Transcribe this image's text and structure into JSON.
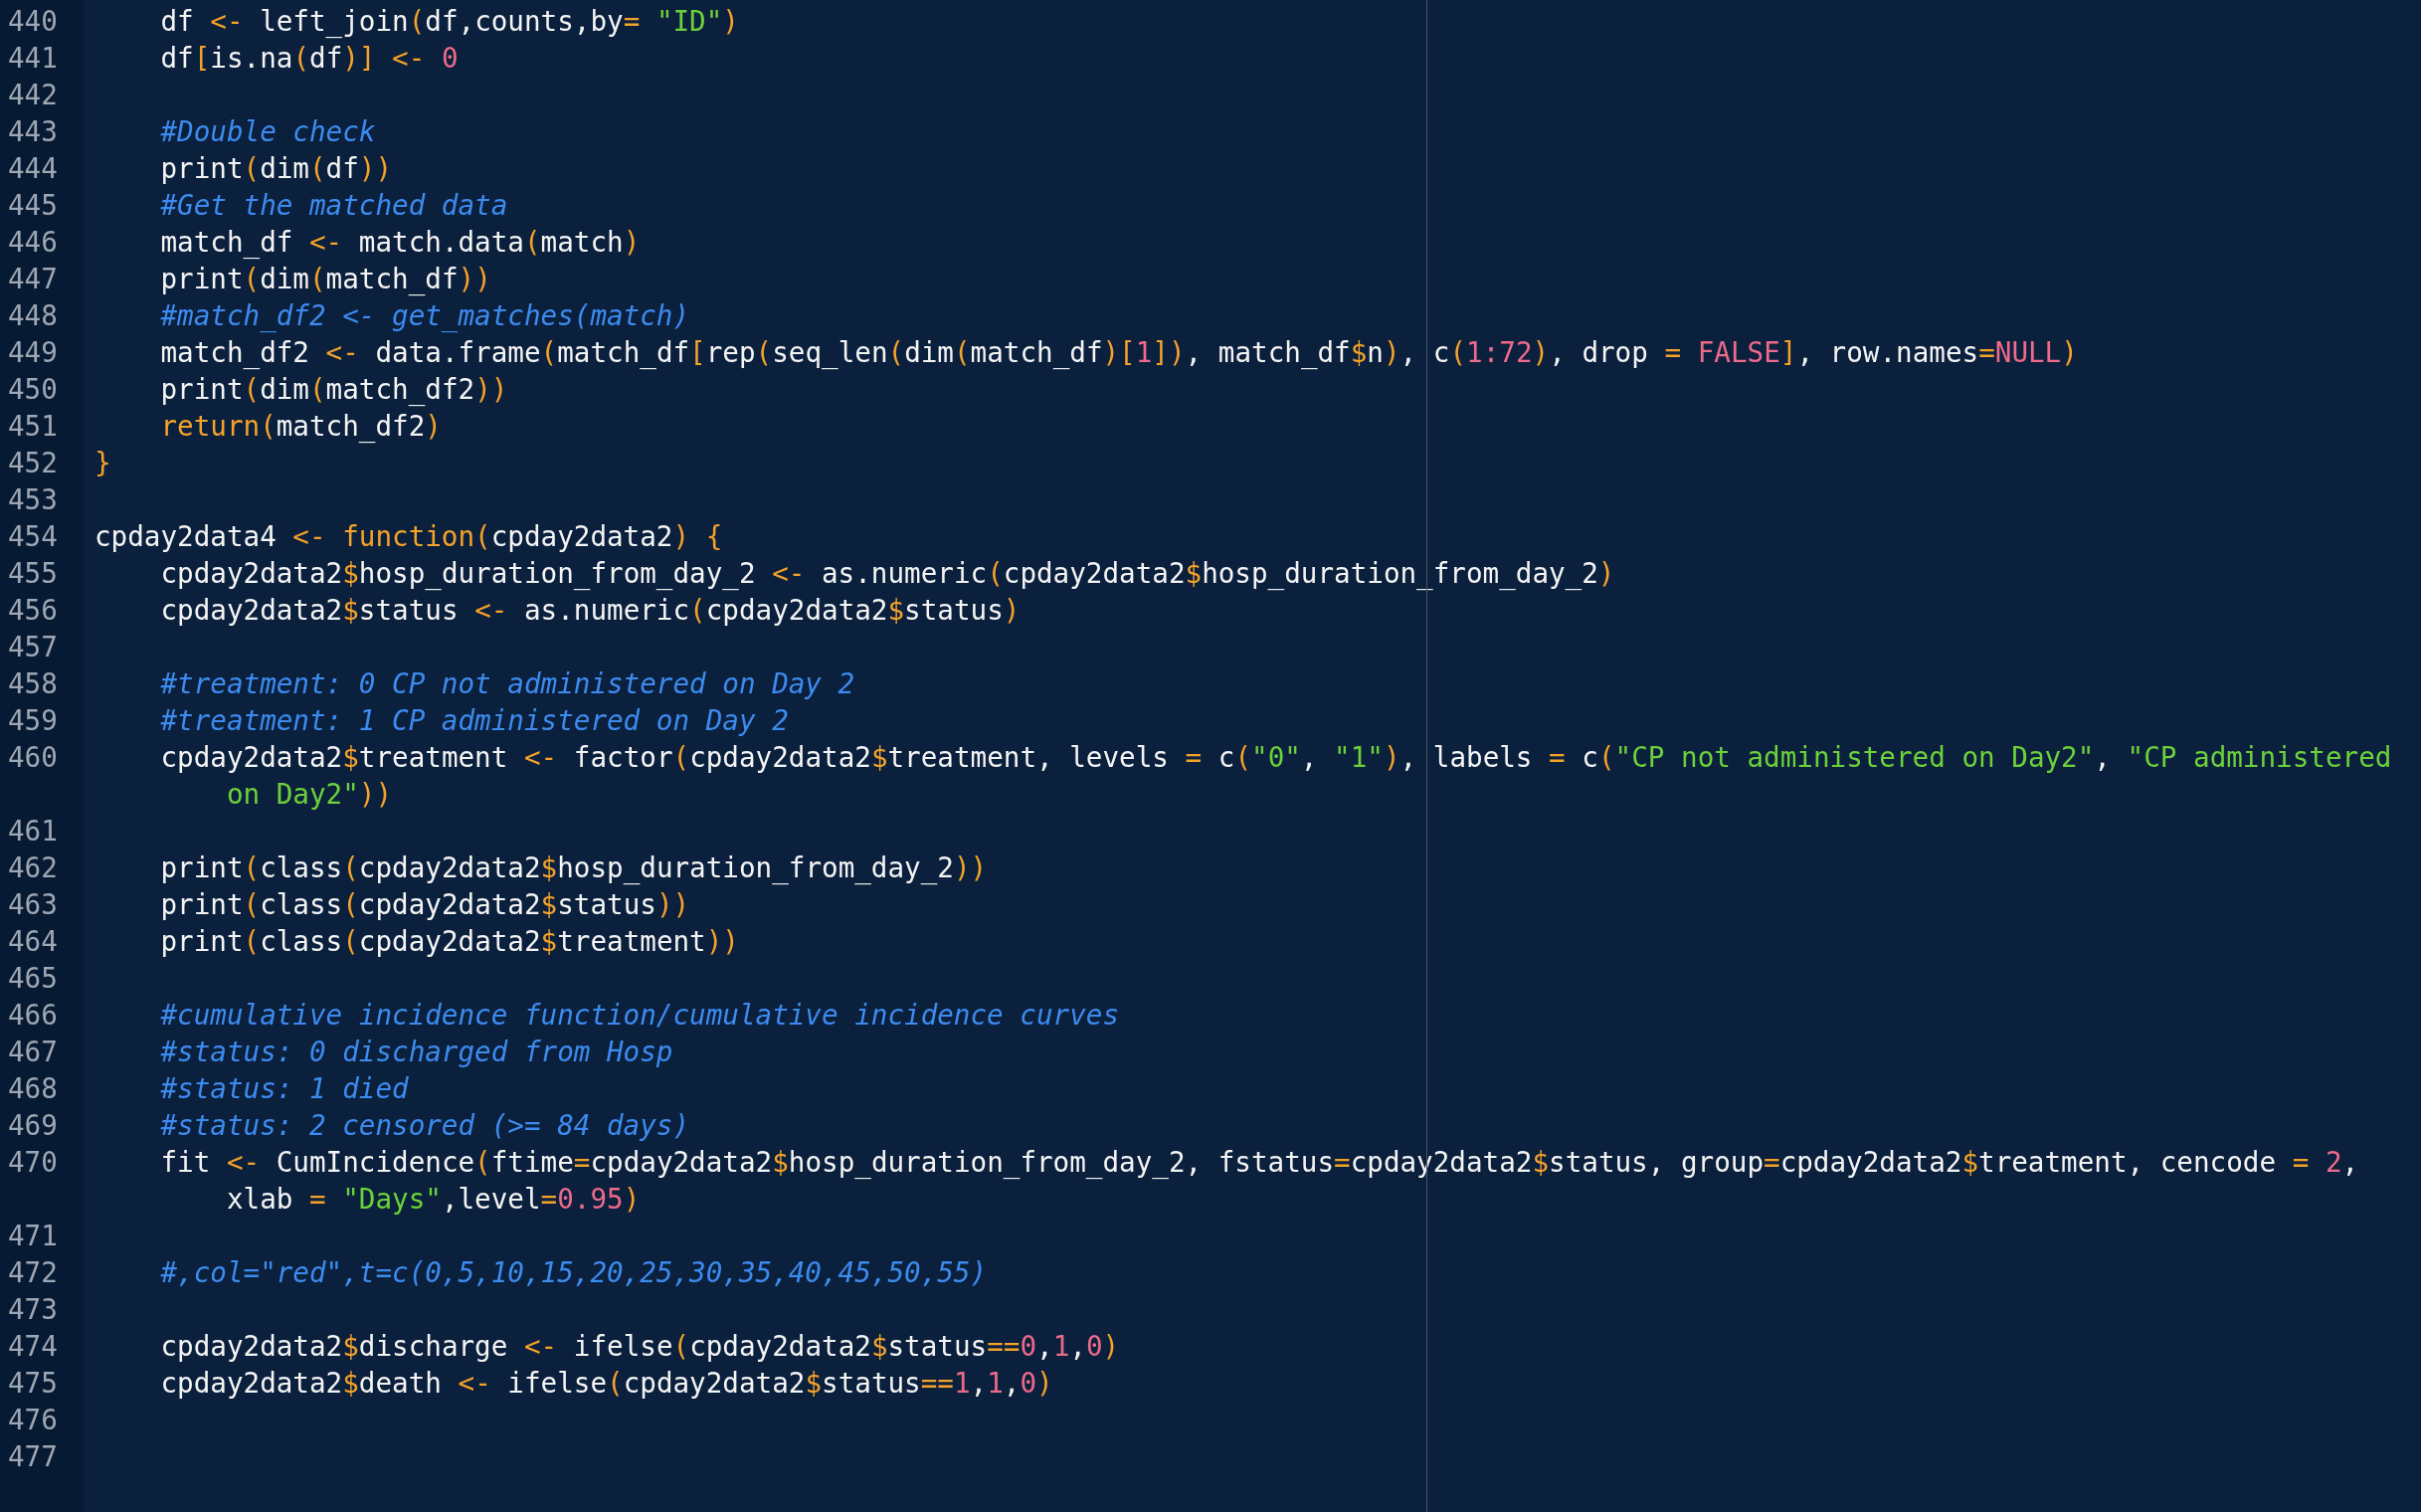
{
  "editor": {
    "lines": [
      {
        "number": "440",
        "tokens": [
          {
            "kind": "plain",
            "text": "    df "
          },
          {
            "kind": "operator",
            "text": "<-"
          },
          {
            "kind": "plain",
            "text": " left_join"
          },
          {
            "kind": "operator",
            "text": "("
          },
          {
            "kind": "plain",
            "text": "df,counts,by"
          },
          {
            "kind": "operator",
            "text": "="
          },
          {
            "kind": "string",
            "text": " \"ID\""
          },
          {
            "kind": "operator",
            "text": ")"
          }
        ]
      },
      {
        "number": "441",
        "tokens": [
          {
            "kind": "plain",
            "text": "    df"
          },
          {
            "kind": "operator",
            "text": "["
          },
          {
            "kind": "plain",
            "text": "is.na"
          },
          {
            "kind": "operator",
            "text": "("
          },
          {
            "kind": "plain",
            "text": "df"
          },
          {
            "kind": "operator",
            "text": ")] <-"
          },
          {
            "kind": "number",
            "text": " 0"
          }
        ]
      },
      {
        "number": "442"
      },
      {
        "number": "443",
        "tokens": [
          {
            "kind": "comment",
            "text": "    #Double check"
          }
        ]
      },
      {
        "number": "444",
        "tokens": [
          {
            "kind": "plain",
            "text": "    print"
          },
          {
            "kind": "operator",
            "text": "("
          },
          {
            "kind": "plain",
            "text": "dim"
          },
          {
            "kind": "operator",
            "text": "("
          },
          {
            "kind": "plain",
            "text": "df"
          },
          {
            "kind": "operator",
            "text": "))"
          }
        ]
      },
      {
        "number": "445",
        "tokens": [
          {
            "kind": "comment",
            "text": "    #Get the matched data"
          }
        ]
      },
      {
        "number": "446",
        "tokens": [
          {
            "kind": "plain",
            "text": "    match_df "
          },
          {
            "kind": "operator",
            "text": "<-"
          },
          {
            "kind": "plain",
            "text": " match.data"
          },
          {
            "kind": "operator",
            "text": "("
          },
          {
            "kind": "plain",
            "text": "match"
          },
          {
            "kind": "operator",
            "text": ")"
          }
        ]
      },
      {
        "number": "447",
        "tokens": [
          {
            "kind": "plain",
            "text": "    print"
          },
          {
            "kind": "operator",
            "text": "("
          },
          {
            "kind": "plain",
            "text": "dim"
          },
          {
            "kind": "operator",
            "text": "("
          },
          {
            "kind": "plain",
            "text": "match_df"
          },
          {
            "kind": "operator",
            "text": "))"
          }
        ]
      },
      {
        "number": "448",
        "tokens": [
          {
            "kind": "comment",
            "text": "    #match_df2 <- get_matches(match)"
          }
        ]
      },
      {
        "number": "449",
        "tokens": [
          {
            "kind": "plain",
            "text": "    match_df2 "
          },
          {
            "kind": "operator",
            "text": "<-"
          },
          {
            "kind": "plain",
            "text": " data.frame"
          },
          {
            "kind": "operator",
            "text": "("
          },
          {
            "kind": "plain",
            "text": "match_df"
          },
          {
            "kind": "operator",
            "text": "["
          },
          {
            "kind": "plain",
            "text": "rep"
          },
          {
            "kind": "operator",
            "text": "("
          },
          {
            "kind": "plain",
            "text": "seq_len"
          },
          {
            "kind": "operator",
            "text": "("
          },
          {
            "kind": "plain",
            "text": "dim"
          },
          {
            "kind": "operator",
            "text": "("
          },
          {
            "kind": "plain",
            "text": "match_df"
          },
          {
            "kind": "operator",
            "text": ")["
          },
          {
            "kind": "number",
            "text": "1"
          },
          {
            "kind": "operator",
            "text": "])"
          },
          {
            "kind": "plain",
            "text": ", match_df"
          },
          {
            "kind": "operator",
            "text": "$"
          },
          {
            "kind": "plain",
            "text": "n"
          },
          {
            "kind": "operator",
            "text": ")"
          },
          {
            "kind": "plain",
            "text": ", c"
          },
          {
            "kind": "operator",
            "text": "("
          },
          {
            "kind": "number",
            "text": "1:72"
          },
          {
            "kind": "operator",
            "text": ")"
          },
          {
            "kind": "plain",
            "text": ", drop "
          },
          {
            "kind": "operator",
            "text": "="
          },
          {
            "kind": "number",
            "text": " FALSE"
          },
          {
            "kind": "operator",
            "text": "]"
          },
          {
            "kind": "plain",
            "text": ", row.names"
          },
          {
            "kind": "operator",
            "text": "="
          },
          {
            "kind": "number",
            "text": "NULL"
          },
          {
            "kind": "operator",
            "text": ")"
          }
        ]
      },
      {
        "number": "450",
        "tokens": [
          {
            "kind": "plain",
            "text": "    print"
          },
          {
            "kind": "operator",
            "text": "("
          },
          {
            "kind": "plain",
            "text": "dim"
          },
          {
            "kind": "operator",
            "text": "("
          },
          {
            "kind": "plain",
            "text": "match_df2"
          },
          {
            "kind": "operator",
            "text": "))"
          }
        ]
      },
      {
        "number": "451",
        "tokens": [
          {
            "kind": "operator",
            "text": "    return("
          },
          {
            "kind": "plain",
            "text": "match_df2"
          },
          {
            "kind": "operator",
            "text": ")"
          }
        ]
      },
      {
        "number": "452",
        "tokens": [
          {
            "kind": "operator",
            "text": "}"
          }
        ]
      },
      {
        "number": "453"
      },
      {
        "number": "454",
        "tokens": [
          {
            "kind": "plain",
            "text": "cpday2data4 "
          },
          {
            "kind": "operator",
            "text": "<- function("
          },
          {
            "kind": "plain",
            "text": "cpday2data2"
          },
          {
            "kind": "operator",
            "text": ") {"
          }
        ]
      },
      {
        "number": "455",
        "tokens": [
          {
            "kind": "plain",
            "text": "    cpday2data2"
          },
          {
            "kind": "operator",
            "text": "$"
          },
          {
            "kind": "plain",
            "text": "hosp_duration_from_day_2 "
          },
          {
            "kind": "operator",
            "text": "<-"
          },
          {
            "kind": "plain",
            "text": " as.numeric"
          },
          {
            "kind": "operator",
            "text": "("
          },
          {
            "kind": "plain",
            "text": "cpday2data2"
          },
          {
            "kind": "operator",
            "text": "$"
          },
          {
            "kind": "plain",
            "text": "hosp_duration_from_day_2"
          },
          {
            "kind": "operator",
            "text": ")"
          }
        ]
      },
      {
        "number": "456",
        "tokens": [
          {
            "kind": "plain",
            "text": "    cpday2data2"
          },
          {
            "kind": "operator",
            "text": "$"
          },
          {
            "kind": "plain",
            "text": "status "
          },
          {
            "kind": "operator",
            "text": "<-"
          },
          {
            "kind": "plain",
            "text": " as.numeric"
          },
          {
            "kind": "operator",
            "text": "("
          },
          {
            "kind": "plain",
            "text": "cpday2data2"
          },
          {
            "kind": "operator",
            "text": "$"
          },
          {
            "kind": "plain",
            "text": "status"
          },
          {
            "kind": "operator",
            "text": ")"
          }
        ]
      },
      {
        "number": "457"
      },
      {
        "number": "458",
        "tokens": [
          {
            "kind": "comment",
            "text": "    #treatment: 0 CP not administered on Day 2"
          }
        ]
      },
      {
        "number": "459",
        "tokens": [
          {
            "kind": "comment",
            "text": "    #treatment: 1 CP administered on Day 2"
          }
        ]
      },
      {
        "number": "460",
        "tokens": [
          {
            "kind": "plain",
            "text": "    cpday2data2"
          },
          {
            "kind": "operator",
            "text": "$"
          },
          {
            "kind": "plain",
            "text": "treatment "
          },
          {
            "kind": "operator",
            "text": "<-"
          },
          {
            "kind": "plain",
            "text": " factor"
          },
          {
            "kind": "operator",
            "text": "("
          },
          {
            "kind": "plain",
            "text": "cpday2data2"
          },
          {
            "kind": "operator",
            "text": "$"
          },
          {
            "kind": "plain",
            "text": "treatment, levels "
          },
          {
            "kind": "operator",
            "text": "="
          },
          {
            "kind": "plain",
            "text": " c"
          },
          {
            "kind": "operator",
            "text": "("
          },
          {
            "kind": "string",
            "text": "\"0\""
          },
          {
            "kind": "plain",
            "text": ", "
          },
          {
            "kind": "string",
            "text": "\"1\""
          },
          {
            "kind": "operator",
            "text": ")"
          },
          {
            "kind": "plain",
            "text": ", labels "
          },
          {
            "kind": "operator",
            "text": "="
          },
          {
            "kind": "plain",
            "text": " c"
          },
          {
            "kind": "operator",
            "text": "("
          },
          {
            "kind": "string",
            "text": "\"CP not administered on Day2\""
          },
          {
            "kind": "plain",
            "text": ", "
          },
          {
            "kind": "string",
            "text": "\"CP administered"
          }
        ],
        "wrap": [
          {
            "kind": "string",
            "text": "        on Day2\""
          },
          {
            "kind": "operator",
            "text": "))"
          }
        ]
      },
      {
        "number": "461"
      },
      {
        "number": "462",
        "tokens": [
          {
            "kind": "plain",
            "text": "    print"
          },
          {
            "kind": "operator",
            "text": "("
          },
          {
            "kind": "plain",
            "text": "class"
          },
          {
            "kind": "operator",
            "text": "("
          },
          {
            "kind": "plain",
            "text": "cpday2data2"
          },
          {
            "kind": "operator",
            "text": "$"
          },
          {
            "kind": "plain",
            "text": "hosp_duration_from_day_2"
          },
          {
            "kind": "operator",
            "text": "))"
          }
        ]
      },
      {
        "number": "463",
        "tokens": [
          {
            "kind": "plain",
            "text": "    print"
          },
          {
            "kind": "operator",
            "text": "("
          },
          {
            "kind": "plain",
            "text": "class"
          },
          {
            "kind": "operator",
            "text": "("
          },
          {
            "kind": "plain",
            "text": "cpday2data2"
          },
          {
            "kind": "operator",
            "text": "$"
          },
          {
            "kind": "plain",
            "text": "status"
          },
          {
            "kind": "operator",
            "text": "))"
          }
        ]
      },
      {
        "number": "464",
        "tokens": [
          {
            "kind": "plain",
            "text": "    print"
          },
          {
            "kind": "operator",
            "text": "("
          },
          {
            "kind": "plain",
            "text": "class"
          },
          {
            "kind": "operator",
            "text": "("
          },
          {
            "kind": "plain",
            "text": "cpday2data2"
          },
          {
            "kind": "operator",
            "text": "$"
          },
          {
            "kind": "plain",
            "text": "treatment"
          },
          {
            "kind": "operator",
            "text": "))"
          }
        ]
      },
      {
        "number": "465"
      },
      {
        "number": "466",
        "tokens": [
          {
            "kind": "comment",
            "text": "    #cumulative incidence function/cumulative incidence curves"
          }
        ]
      },
      {
        "number": "467",
        "tokens": [
          {
            "kind": "comment",
            "text": "    #status: 0 discharged from Hosp"
          }
        ]
      },
      {
        "number": "468",
        "tokens": [
          {
            "kind": "comment",
            "text": "    #status: 1 died"
          }
        ]
      },
      {
        "number": "469",
        "tokens": [
          {
            "kind": "comment",
            "text": "    #status: 2 censored (>= 84 days)"
          }
        ]
      },
      {
        "number": "470",
        "tokens": [
          {
            "kind": "plain",
            "text": "    fit "
          },
          {
            "kind": "operator",
            "text": "<-"
          },
          {
            "kind": "plain",
            "text": " CumIncidence"
          },
          {
            "kind": "operator",
            "text": "("
          },
          {
            "kind": "plain",
            "text": "ftime"
          },
          {
            "kind": "operator",
            "text": "="
          },
          {
            "kind": "plain",
            "text": "cpday2data2"
          },
          {
            "kind": "operator",
            "text": "$"
          },
          {
            "kind": "plain",
            "text": "hosp_duration_from_day_2, fstatus"
          },
          {
            "kind": "operator",
            "text": "="
          },
          {
            "kind": "plain",
            "text": "cpday2data2"
          },
          {
            "kind": "operator",
            "text": "$"
          },
          {
            "kind": "plain",
            "text": "status, group"
          },
          {
            "kind": "operator",
            "text": "="
          },
          {
            "kind": "plain",
            "text": "cpday2data2"
          },
          {
            "kind": "operator",
            "text": "$"
          },
          {
            "kind": "plain",
            "text": "treatment, cencode "
          },
          {
            "kind": "operator",
            "text": "="
          },
          {
            "kind": "number",
            "text": " 2"
          },
          {
            "kind": "plain",
            "text": ","
          }
        ],
        "wrap": [
          {
            "kind": "plain",
            "text": "        xlab "
          },
          {
            "kind": "operator",
            "text": "="
          },
          {
            "kind": "string",
            "text": " \"Days\""
          },
          {
            "kind": "plain",
            "text": ",level"
          },
          {
            "kind": "operator",
            "text": "="
          },
          {
            "kind": "number",
            "text": "0.95"
          },
          {
            "kind": "operator",
            "text": ")"
          }
        ]
      },
      {
        "number": "471"
      },
      {
        "number": "472",
        "tokens": [
          {
            "kind": "comment",
            "text": "    #,col=\"red\",t=c(0,5,10,15,20,25,30,35,40,45,50,55)"
          }
        ]
      },
      {
        "number": "473"
      },
      {
        "number": "474",
        "tokens": [
          {
            "kind": "plain",
            "text": "    cpday2data2"
          },
          {
            "kind": "operator",
            "text": "$"
          },
          {
            "kind": "plain",
            "text": "discharge "
          },
          {
            "kind": "operator",
            "text": "<-"
          },
          {
            "kind": "plain",
            "text": " ifelse"
          },
          {
            "kind": "operator",
            "text": "("
          },
          {
            "kind": "plain",
            "text": "cpday2data2"
          },
          {
            "kind": "operator",
            "text": "$"
          },
          {
            "kind": "plain",
            "text": "status"
          },
          {
            "kind": "operator",
            "text": "=="
          },
          {
            "kind": "number",
            "text": "0"
          },
          {
            "kind": "plain",
            "text": ","
          },
          {
            "kind": "number",
            "text": "1"
          },
          {
            "kind": "plain",
            "text": ","
          },
          {
            "kind": "number",
            "text": "0"
          },
          {
            "kind": "operator",
            "text": ")"
          }
        ]
      },
      {
        "number": "475",
        "tokens": [
          {
            "kind": "plain",
            "text": "    cpday2data2"
          },
          {
            "kind": "operator",
            "text": "$"
          },
          {
            "kind": "plain",
            "text": "death "
          },
          {
            "kind": "operator",
            "text": "<-"
          },
          {
            "kind": "plain",
            "text": " ifelse"
          },
          {
            "kind": "operator",
            "text": "("
          },
          {
            "kind": "plain",
            "text": "cpday2data2"
          },
          {
            "kind": "operator",
            "text": "$"
          },
          {
            "kind": "plain",
            "text": "status"
          },
          {
            "kind": "operator",
            "text": "=="
          },
          {
            "kind": "number",
            "text": "1"
          },
          {
            "kind": "plain",
            "text": ","
          },
          {
            "kind": "number",
            "text": "1"
          },
          {
            "kind": "plain",
            "text": ","
          },
          {
            "kind": "number",
            "text": "0"
          },
          {
            "kind": "operator",
            "text": ")"
          }
        ]
      },
      {
        "number": "476"
      },
      {
        "number": "477"
      }
    ]
  }
}
